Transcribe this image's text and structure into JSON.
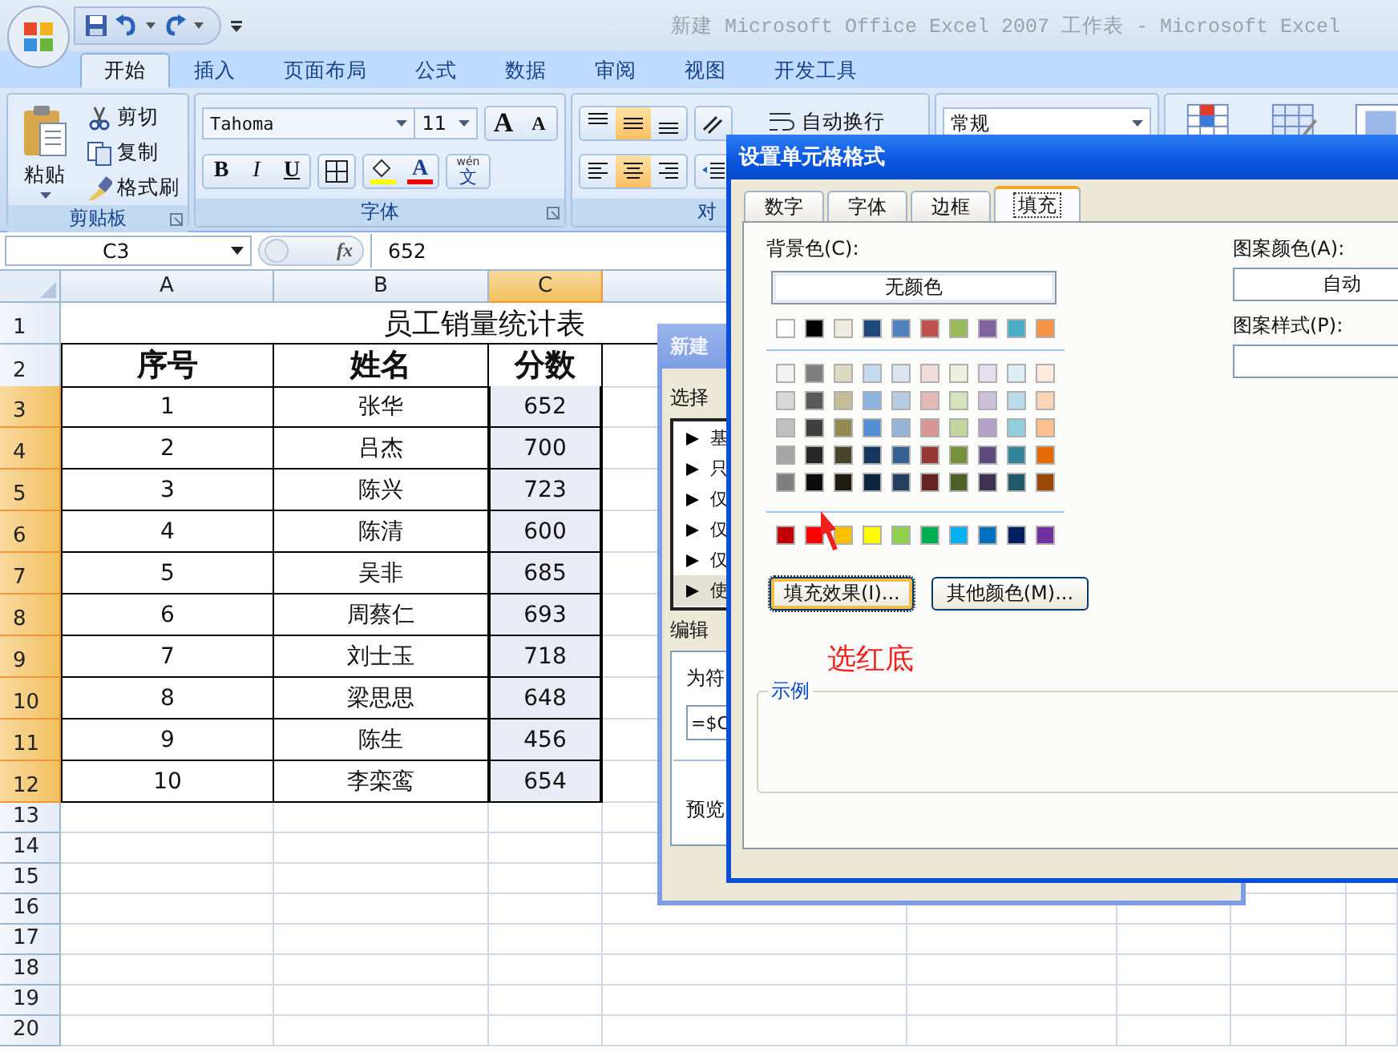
{
  "window": {
    "title": "新建 Microsoft Office Excel 2007 工作表 - Microsoft Excel"
  },
  "ribbon_tabs": [
    {
      "label": "开始",
      "selected": true
    },
    {
      "label": "插入",
      "selected": false
    },
    {
      "label": "页面布局",
      "selected": false
    },
    {
      "label": "公式",
      "selected": false
    },
    {
      "label": "数据",
      "selected": false
    },
    {
      "label": "审阅",
      "selected": false
    },
    {
      "label": "视图",
      "selected": false
    },
    {
      "label": "开发工具",
      "selected": false
    }
  ],
  "ribbon": {
    "clipboard": {
      "label": "剪贴板",
      "paste": "粘贴",
      "items": [
        {
          "kind": "cut",
          "label": "剪切"
        },
        {
          "kind": "copy",
          "label": "复制"
        },
        {
          "kind": "painter",
          "label": "格式刷"
        }
      ]
    },
    "font": {
      "label": "字体",
      "family": "Tahoma",
      "size": "11",
      "grow": "A",
      "shrink": "A",
      "styles": [
        {
          "kind": "bold",
          "label": "B"
        },
        {
          "kind": "italic",
          "label": "I"
        },
        {
          "kind": "underline",
          "label": "U"
        }
      ],
      "font_color_letter": "A",
      "phonetic_ruby": "wén",
      "phonetic_char": "文"
    },
    "alignment": {
      "label": "对",
      "vertical": [
        {
          "kind": "top",
          "selected": false
        },
        {
          "kind": "middle",
          "selected": true
        },
        {
          "kind": "bottom",
          "selected": false
        }
      ],
      "horizontal": [
        {
          "kind": "left",
          "selected": false
        },
        {
          "kind": "center",
          "selected": true
        },
        {
          "kind": "right",
          "selected": false
        }
      ],
      "wrap_text": "自动换行"
    },
    "number": {
      "format": "常规"
    }
  },
  "formula_bar": {
    "cell": "C3",
    "fx": "fx",
    "value": "652"
  },
  "sheet": {
    "columns": [
      {
        "label": "A",
        "selected": false
      },
      {
        "label": "B",
        "selected": false
      },
      {
        "label": "C",
        "selected": true
      }
    ],
    "rows": [
      {
        "header": "1",
        "selected": false,
        "kind": "title",
        "cells": [
          "员工销量统计表"
        ]
      },
      {
        "header": "2",
        "selected": false,
        "kind": "heading",
        "cells": [
          "序号",
          "姓名",
          "分数"
        ]
      },
      {
        "header": "3",
        "selected": true,
        "kind": "data",
        "cells": [
          "1",
          "张华",
          "652"
        ]
      },
      {
        "header": "4",
        "selected": true,
        "kind": "data",
        "cells": [
          "2",
          "吕杰",
          "700"
        ]
      },
      {
        "header": "5",
        "selected": true,
        "kind": "data",
        "cells": [
          "3",
          "陈兴",
          "723"
        ]
      },
      {
        "header": "6",
        "selected": true,
        "kind": "data",
        "cells": [
          "4",
          "陈清",
          "600"
        ]
      },
      {
        "header": "7",
        "selected": true,
        "kind": "data",
        "cells": [
          "5",
          "吴非",
          "685"
        ]
      },
      {
        "header": "8",
        "selected": true,
        "kind": "data",
        "cells": [
          "6",
          "周蔡仁",
          "693"
        ]
      },
      {
        "header": "9",
        "selected": true,
        "kind": "data",
        "cells": [
          "7",
          "刘士玉",
          "718"
        ]
      },
      {
        "header": "10",
        "selected": true,
        "kind": "data",
        "cells": [
          "8",
          "梁思思",
          "648"
        ]
      },
      {
        "header": "11",
        "selected": true,
        "kind": "data",
        "cells": [
          "9",
          "陈生",
          "456"
        ]
      },
      {
        "header": "12",
        "selected": true,
        "kind": "data",
        "cells": [
          "10",
          "李栾鸾",
          "654"
        ]
      },
      {
        "header": "13",
        "selected": false,
        "kind": "empty"
      },
      {
        "header": "14",
        "selected": false,
        "kind": "empty"
      },
      {
        "header": "15",
        "selected": false,
        "kind": "empty"
      },
      {
        "header": "16",
        "selected": false,
        "kind": "empty"
      },
      {
        "header": "17",
        "selected": false,
        "kind": "empty"
      },
      {
        "header": "18",
        "selected": false,
        "kind": "empty"
      },
      {
        "header": "19",
        "selected": false,
        "kind": "empty"
      },
      {
        "header": "20",
        "selected": false,
        "kind": "empty"
      }
    ]
  },
  "rule_dialog": {
    "title": "新建",
    "rule_type_label": "选择",
    "rule_types": [
      {
        "label": "基",
        "selected": false
      },
      {
        "label": "只",
        "selected": false
      },
      {
        "label": "仅",
        "selected": false
      },
      {
        "label": "仅",
        "selected": false
      },
      {
        "label": "仅",
        "selected": false
      },
      {
        "label": "使",
        "selected": true
      }
    ],
    "edit_label": "编辑",
    "condition_label": "为符",
    "formula": "=$C",
    "preview_label": "预览"
  },
  "format_dialog": {
    "title": "设置单元格格式",
    "tabs": [
      {
        "label": "数字",
        "selected": false
      },
      {
        "label": "字体",
        "selected": false
      },
      {
        "label": "边框",
        "selected": false
      },
      {
        "label": "填充",
        "selected": true
      }
    ],
    "background_label": "背景色(C):",
    "no_color": "无颜色",
    "theme_colors": [
      {
        "color": "#ffffff"
      },
      {
        "color": "#000000"
      },
      {
        "color": "#eeece1"
      },
      {
        "color": "#1f497d"
      },
      {
        "color": "#4f81bd"
      },
      {
        "color": "#c0504d"
      },
      {
        "color": "#9bbb59"
      },
      {
        "color": "#8064a2"
      },
      {
        "color": "#4bacc6"
      },
      {
        "color": "#f79646"
      }
    ],
    "tints": [
      {
        "swatches": [
          {
            "color": "#f2f2f2"
          },
          {
            "color": "#7f7f7f"
          },
          {
            "color": "#ddd9c3"
          },
          {
            "color": "#c6d9f0"
          },
          {
            "color": "#dbe5f1"
          },
          {
            "color": "#f2dcdb"
          },
          {
            "color": "#ebf1dd"
          },
          {
            "color": "#e5e0ec"
          },
          {
            "color": "#dbeef3"
          },
          {
            "color": "#fdeada"
          }
        ]
      },
      {
        "swatches": [
          {
            "color": "#d8d8d8"
          },
          {
            "color": "#595959"
          },
          {
            "color": "#c4bd97"
          },
          {
            "color": "#8db3e2"
          },
          {
            "color": "#b8cce4"
          },
          {
            "color": "#e5b9b7"
          },
          {
            "color": "#d7e3bc"
          },
          {
            "color": "#ccc1d9"
          },
          {
            "color": "#b7dde8"
          },
          {
            "color": "#fbd5b5"
          }
        ]
      },
      {
        "swatches": [
          {
            "color": "#bfbfbf"
          },
          {
            "color": "#3f3f3f"
          },
          {
            "color": "#938953"
          },
          {
            "color": "#548dd4"
          },
          {
            "color": "#95b3d7"
          },
          {
            "color": "#d99694"
          },
          {
            "color": "#c3d69b"
          },
          {
            "color": "#b2a2c7"
          },
          {
            "color": "#92cddc"
          },
          {
            "color": "#fac08f"
          }
        ]
      },
      {
        "swatches": [
          {
            "color": "#a5a5a5"
          },
          {
            "color": "#262626"
          },
          {
            "color": "#494429"
          },
          {
            "color": "#17365d"
          },
          {
            "color": "#366092"
          },
          {
            "color": "#953734"
          },
          {
            "color": "#76923c"
          },
          {
            "color": "#5f497a"
          },
          {
            "color": "#31859b"
          },
          {
            "color": "#e36c09"
          }
        ]
      },
      {
        "swatches": [
          {
            "color": "#7f7f7f"
          },
          {
            "color": "#0c0c0c"
          },
          {
            "color": "#1d1b10"
          },
          {
            "color": "#0f243e"
          },
          {
            "color": "#244061"
          },
          {
            "color": "#632423"
          },
          {
            "color": "#4f6128"
          },
          {
            "color": "#3f3151"
          },
          {
            "color": "#205867"
          },
          {
            "color": "#974806"
          }
        ]
      }
    ],
    "standard_colors": [
      {
        "color": "#c00000"
      },
      {
        "color": "#ff0000"
      },
      {
        "color": "#ffc000"
      },
      {
        "color": "#ffff00"
      },
      {
        "color": "#92d050"
      },
      {
        "color": "#00b050"
      },
      {
        "color": "#00b0f0"
      },
      {
        "color": "#0070c0"
      },
      {
        "color": "#002060"
      },
      {
        "color": "#7030a0"
      }
    ],
    "buttons": [
      {
        "label": "填充效果(I)...",
        "focused": true
      },
      {
        "label": "其他颜色(M)...",
        "focused": false
      }
    ],
    "sample_label": "示例",
    "pattern_color_label": "图案颜色(A):",
    "pattern_color": "自动",
    "pattern_style_label": "图案样式(P):"
  },
  "annotation": {
    "text": "选红底"
  }
}
